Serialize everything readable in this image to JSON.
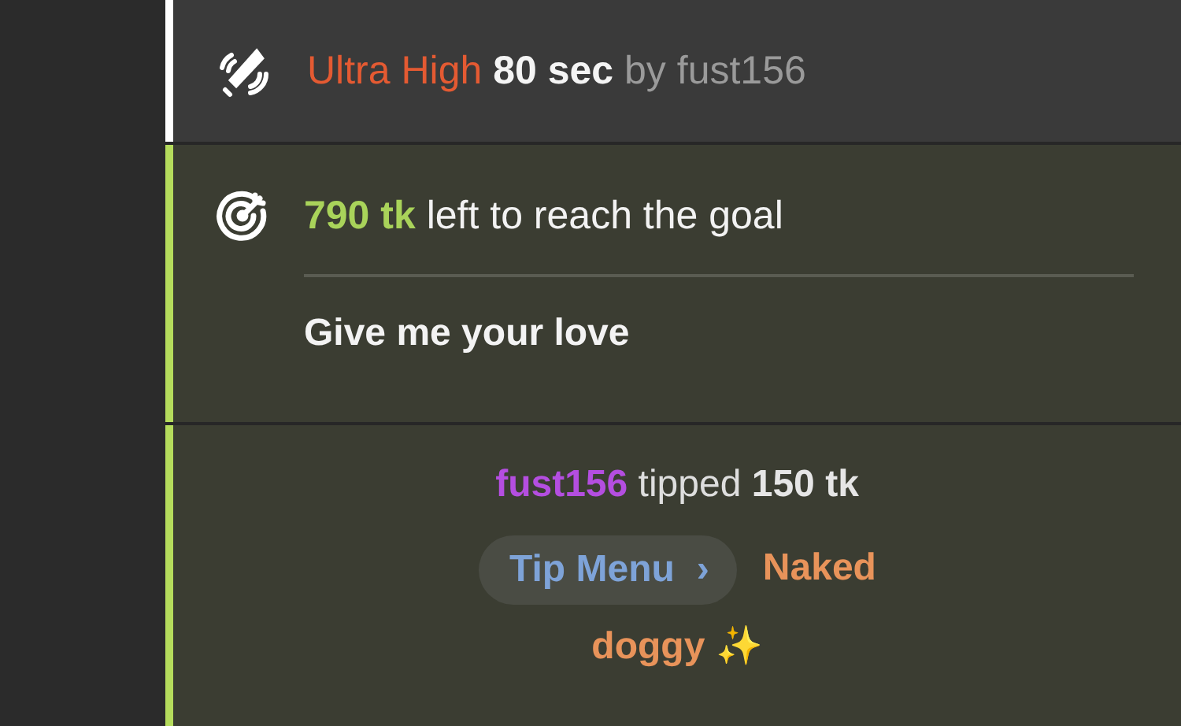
{
  "messages": [
    {
      "kind": "vibration",
      "color": "#ffffff",
      "level_name": "Ultra High",
      "duration": "80 sec",
      "by": "by",
      "user": "fust156"
    },
    {
      "kind": "goal",
      "color": "#b5dc5c",
      "amount": "790 tk",
      "text": "left to reach the goal",
      "goal_title": "Give me your love"
    },
    {
      "kind": "tip",
      "color": "#b5dc5c",
      "user": "fust156",
      "verb": "tipped",
      "amount": "150 tk",
      "menu_button": "Tip Menu",
      "chevron": "›",
      "item_lines": [
        "Naked",
        "doggy ✨"
      ]
    }
  ]
}
